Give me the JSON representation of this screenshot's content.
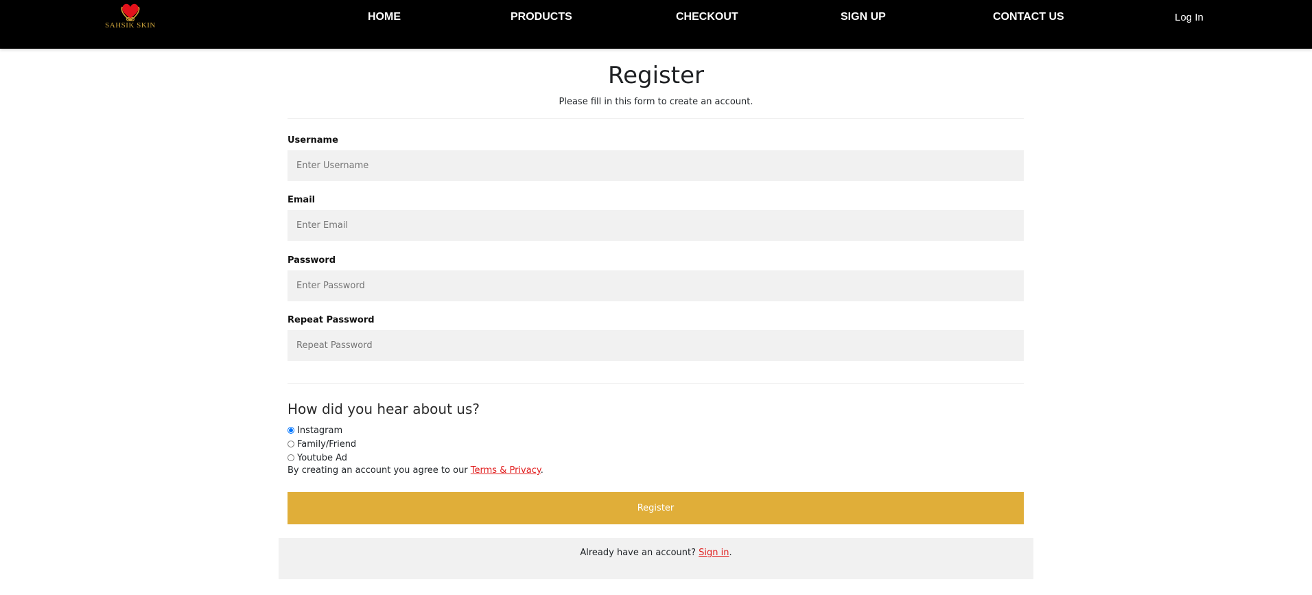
{
  "nav": {
    "logo_text": "SAHSIK SKIN",
    "links": [
      "HOME",
      "PRODUCTS",
      "CHECKOUT",
      "SIGN UP",
      "CONTACT US"
    ],
    "login": "Log In"
  },
  "form": {
    "title": "Register",
    "subtitle": "Please fill in this form to create an account.",
    "fields": [
      {
        "label": "Username",
        "placeholder": "Enter Username",
        "value": ""
      },
      {
        "label": "Email",
        "placeholder": "Enter Email",
        "value": ""
      },
      {
        "label": "Password",
        "placeholder": "Enter Password",
        "value": ""
      },
      {
        "label": "Repeat Password",
        "placeholder": "Repeat Password",
        "value": ""
      }
    ],
    "question": "How did you hear about us?",
    "options": [
      {
        "label": "Instagram",
        "checked": true
      },
      {
        "label": "Family/Friend",
        "checked": false
      },
      {
        "label": "Youtube Ad",
        "checked": false
      }
    ],
    "terms_prefix": "By creating an account you agree to our ",
    "terms_link": "Terms & Privacy",
    "terms_suffix": ".",
    "register_button": "Register"
  },
  "signin": {
    "prefix": "Already have an account? ",
    "link": "Sign in",
    "suffix": "."
  },
  "colors": {
    "nav_bg": "#000000",
    "accent": "#e0ae39",
    "link": "#e11d1d",
    "input_bg": "#f1f1f1"
  }
}
